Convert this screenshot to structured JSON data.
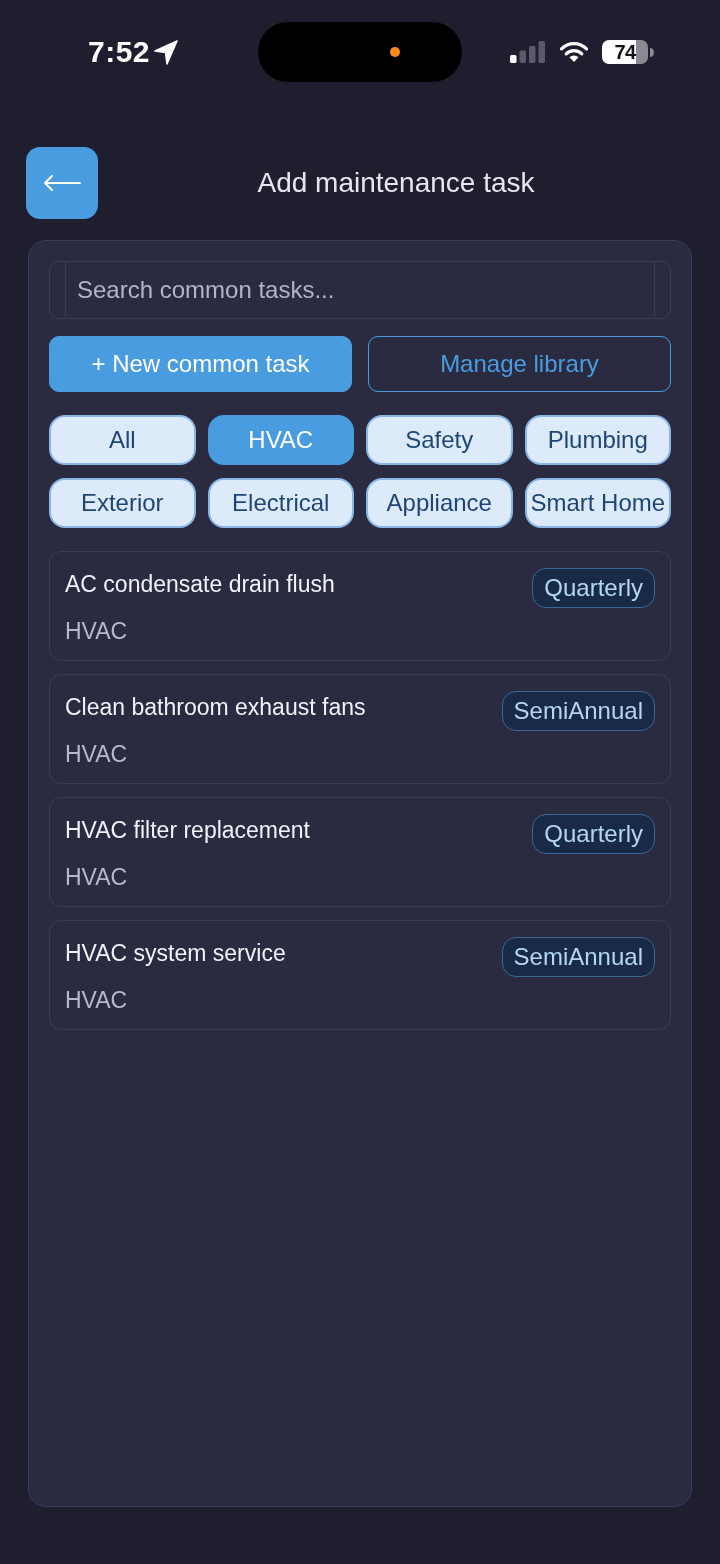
{
  "status_bar": {
    "time": "7:52",
    "battery": "74"
  },
  "header": {
    "title": "Add maintenance task"
  },
  "search": {
    "placeholder": "Search common tasks..."
  },
  "actions": [
    {
      "label": "+ New common task",
      "kind": "primary"
    },
    {
      "label": "Manage library",
      "kind": "outline"
    }
  ],
  "filters": [
    {
      "label": "All",
      "selected": false
    },
    {
      "label": "HVAC",
      "selected": true
    },
    {
      "label": "Safety",
      "selected": false
    },
    {
      "label": "Plumbing",
      "selected": false
    },
    {
      "label": "Exterior",
      "selected": false
    },
    {
      "label": "Electrical",
      "selected": false
    },
    {
      "label": "Appliance",
      "selected": false
    },
    {
      "label": "Smart Home",
      "selected": false
    }
  ],
  "tasks": [
    {
      "title": "AC condensate drain flush",
      "category": "HVAC",
      "frequency": "Quarterly"
    },
    {
      "title": "Clean bathroom exhaust fans",
      "category": "HVAC",
      "frequency": "SemiAnnual"
    },
    {
      "title": "HVAC filter replacement",
      "category": "HVAC",
      "frequency": "Quarterly"
    },
    {
      "title": "HVAC system service",
      "category": "HVAC",
      "frequency": "SemiAnnual"
    }
  ]
}
